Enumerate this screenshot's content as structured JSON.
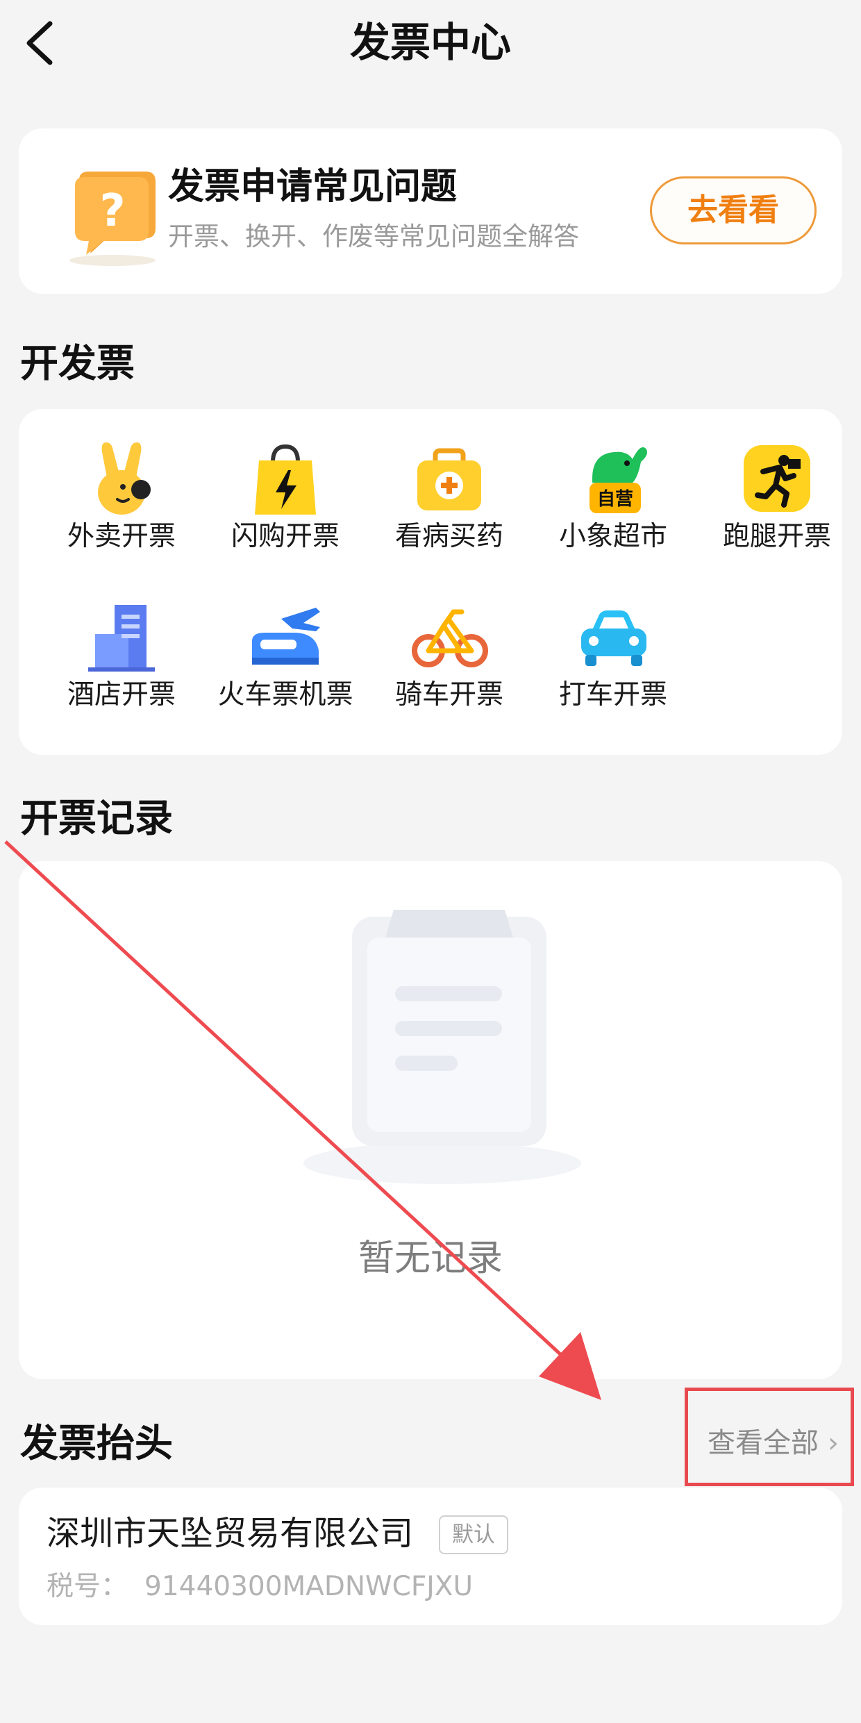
{
  "nav": {
    "title": "发票中心"
  },
  "faq": {
    "title": "发票申请常见问题",
    "subtitle": "开票、换开、作废等常见问题全解答",
    "button": "去看看"
  },
  "sections": {
    "open_invoice": "开发票",
    "records": "开票记录",
    "invoice_title": "发票抬头"
  },
  "services": [
    {
      "label": "外卖开票",
      "icon": "waimai-bunny-icon"
    },
    {
      "label": "闪购开票",
      "icon": "shangou-bag-icon"
    },
    {
      "label": "看病买药",
      "icon": "medicine-kit-icon"
    },
    {
      "label": "小象超市",
      "icon": "elephant-supermarket-icon",
      "badge": "自营"
    },
    {
      "label": "跑腿开票",
      "icon": "errand-runner-icon"
    },
    {
      "label": "酒店开票",
      "icon": "hotel-icon"
    },
    {
      "label": "火车票机票",
      "icon": "train-plane-icon"
    },
    {
      "label": "骑车开票",
      "icon": "bike-icon"
    },
    {
      "label": "打车开票",
      "icon": "car-icon"
    }
  ],
  "records": {
    "empty_text": "暂无记录"
  },
  "invoice_title": {
    "view_all": "查看全部",
    "view_all_chevron": "›",
    "company": "深圳市天坠贸易有限公司",
    "default_tag": "默认",
    "tax_label": "税号：",
    "tax_number": "91440300MADNWCFJXU"
  },
  "colors": {
    "accent_orange": "#f07f12",
    "highlight_red": "#e84a4f",
    "background": "#f4f4f4"
  }
}
